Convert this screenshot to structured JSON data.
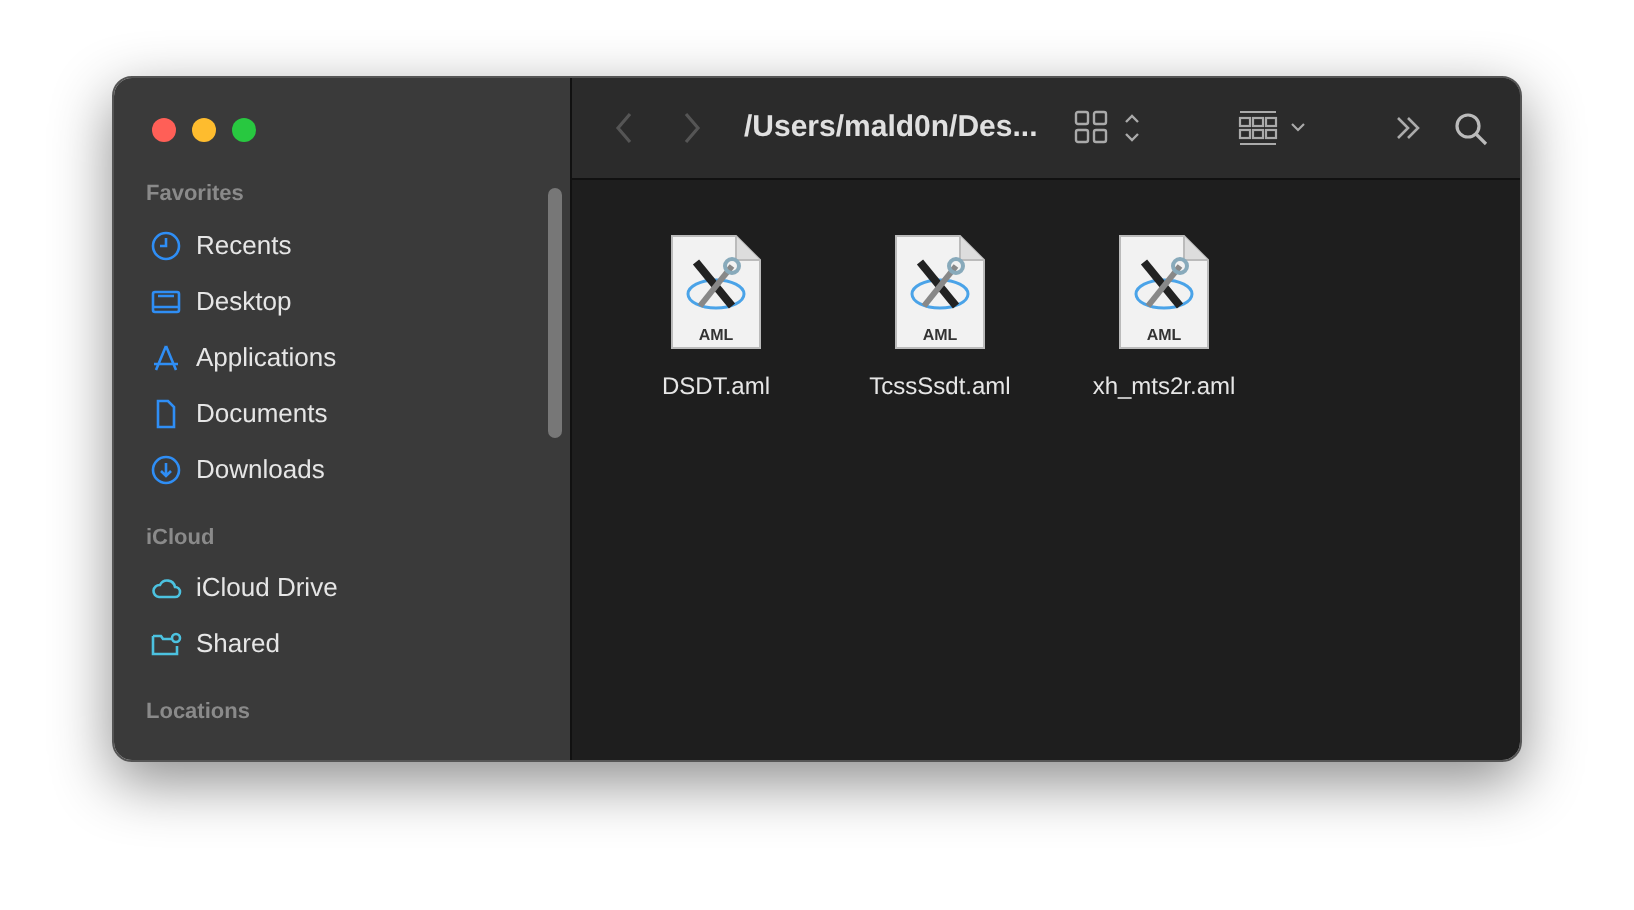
{
  "window": {
    "title": "/Users/mald0n/Des..."
  },
  "sidebar": {
    "sections": [
      {
        "heading": "Favorites",
        "items": [
          {
            "label": "Recents",
            "kind": "clock",
            "selected": false
          },
          {
            "label": "Desktop",
            "kind": "desktop",
            "selected": false
          },
          {
            "label": "Applications",
            "kind": "apps",
            "selected": false
          },
          {
            "label": "Documents",
            "kind": "doc",
            "selected": false
          },
          {
            "label": "Downloads",
            "kind": "download",
            "selected": false
          }
        ]
      },
      {
        "heading": "iCloud",
        "items": [
          {
            "label": "iCloud Drive",
            "kind": "cloud",
            "selected": false
          },
          {
            "label": "Shared",
            "kind": "shared",
            "selected": false
          }
        ]
      },
      {
        "heading": "Locations"
      }
    ]
  },
  "files": [
    {
      "name": "DSDT.aml",
      "type_label": "AML"
    },
    {
      "name": "TcssSsdt.aml",
      "type_label": "AML"
    },
    {
      "name": "xh_mts2r.aml",
      "type_label": "AML"
    }
  ]
}
